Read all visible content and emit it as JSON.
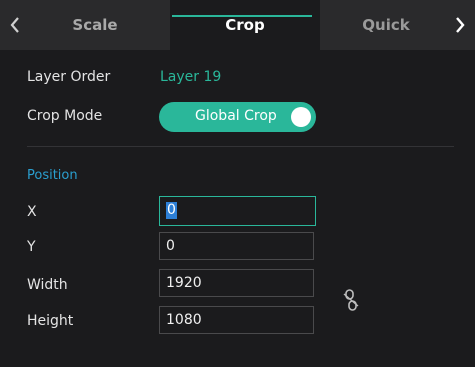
{
  "tabs": {
    "scale": "Scale",
    "crop": "Crop",
    "quick": "Quick",
    "active": "Crop"
  },
  "nav": {
    "left_icon": "chevron-left-icon",
    "right_icon": "chevron-right-icon"
  },
  "layer_order": {
    "label": "Layer Order",
    "value": "Layer 19"
  },
  "crop_mode": {
    "label": "Crop Mode",
    "value": "Global Crop",
    "enabled": true
  },
  "position": {
    "heading": "Position",
    "x": {
      "label": "X",
      "value": "0"
    },
    "y": {
      "label": "Y",
      "value": "0"
    },
    "width": {
      "label": "Width",
      "value": "1920"
    },
    "height": {
      "label": "Height",
      "value": "1080"
    }
  },
  "link_icon": "unlinked-chain-icon",
  "colors": {
    "accent": "#2ab79a",
    "heading": "#2a9fcf",
    "background": "#1b1b1d",
    "tabbar": "#2a2a2c"
  }
}
